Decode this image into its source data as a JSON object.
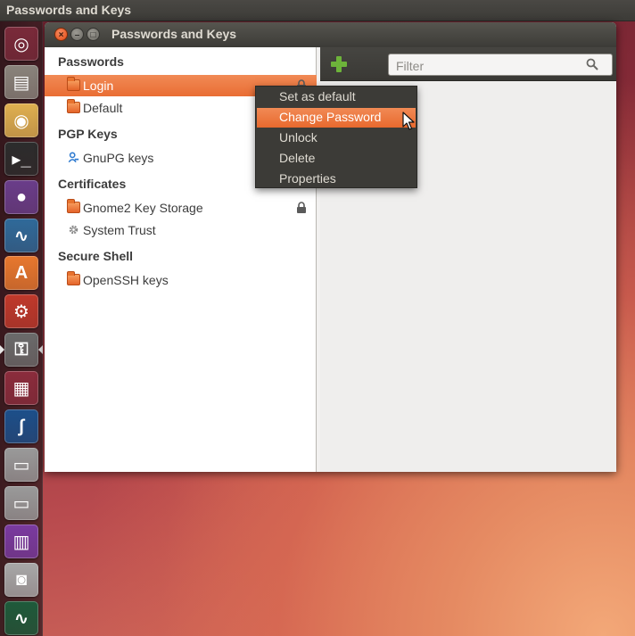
{
  "top_panel": {
    "title": "Passwords and Keys"
  },
  "window": {
    "title": "Passwords and Keys",
    "close_glyph": "×",
    "min_glyph": "–",
    "max_glyph": "□"
  },
  "sidebar": {
    "sections": [
      {
        "header": "Passwords",
        "items": [
          {
            "label": "Login",
            "icon": "folder-icon",
            "selected": true,
            "locked": true
          },
          {
            "label": "Default",
            "icon": "folder-icon",
            "selected": false,
            "locked": false
          }
        ]
      },
      {
        "header": "PGP Keys",
        "items": [
          {
            "label": "GnuPG keys",
            "icon": "key-person-icon",
            "selected": false,
            "locked": false
          }
        ]
      },
      {
        "header": "Certificates",
        "items": [
          {
            "label": "Gnome2 Key Storage",
            "icon": "folder-icon",
            "selected": false,
            "locked": true
          },
          {
            "label": "System Trust",
            "icon": "gear-icon",
            "selected": false,
            "locked": false
          }
        ]
      },
      {
        "header": "Secure Shell",
        "items": [
          {
            "label": "OpenSSH keys",
            "icon": "folder-icon",
            "selected": false,
            "locked": false
          }
        ]
      }
    ]
  },
  "toolbar": {
    "add_icon": "plus-icon",
    "filter_placeholder": "Filter",
    "search_icon": "search-icon"
  },
  "context_menu": {
    "items": [
      {
        "label": "Set as default",
        "highlighted": false
      },
      {
        "label": "Change Password",
        "highlighted": true
      },
      {
        "label": "Unlock",
        "highlighted": false
      },
      {
        "label": "Delete",
        "highlighted": false
      },
      {
        "label": "Properties",
        "highlighted": false
      }
    ]
  },
  "launcher": {
    "items": [
      {
        "name": "dash-home-icon",
        "glyph": "◎",
        "color": "#7a2a3a"
      },
      {
        "name": "file-manager-icon",
        "glyph": "▤",
        "color": "#8a847c"
      },
      {
        "name": "chromium-icon",
        "glyph": "◉",
        "color": "#e0b050"
      },
      {
        "name": "terminal-icon",
        "glyph": "▸_",
        "color": "#2c2c2c"
      },
      {
        "name": "molecule-app-icon",
        "glyph": "●",
        "color": "#6a3d8a"
      },
      {
        "name": "system-monitor-icon",
        "glyph": "∿",
        "color": "#2f6a9a"
      },
      {
        "name": "software-center-icon",
        "glyph": "A",
        "color": "#e8782e"
      },
      {
        "name": "system-settings-icon",
        "glyph": "⚙",
        "color": "#c0392b"
      },
      {
        "name": "passwords-and-keys-icon",
        "glyph": "⚿",
        "color": "#6b6b6b"
      },
      {
        "name": "workspace-switcher-icon",
        "glyph": "▦",
        "color": "#8b2c3c"
      },
      {
        "name": "wireshark-icon",
        "glyph": "∫",
        "color": "#1c4f8a"
      },
      {
        "name": "drive-icon",
        "glyph": "▭",
        "color": "#9a9a9a"
      },
      {
        "name": "drive-2-icon",
        "glyph": "▭",
        "color": "#9a9a9a"
      },
      {
        "name": "app-window-icon",
        "glyph": "▥",
        "color": "#7a3aa0"
      },
      {
        "name": "camera-icon",
        "glyph": "◙",
        "color": "#a8a8a8"
      },
      {
        "name": "pulse-monitor-icon",
        "glyph": "∿",
        "color": "#1e5a3a"
      }
    ]
  }
}
